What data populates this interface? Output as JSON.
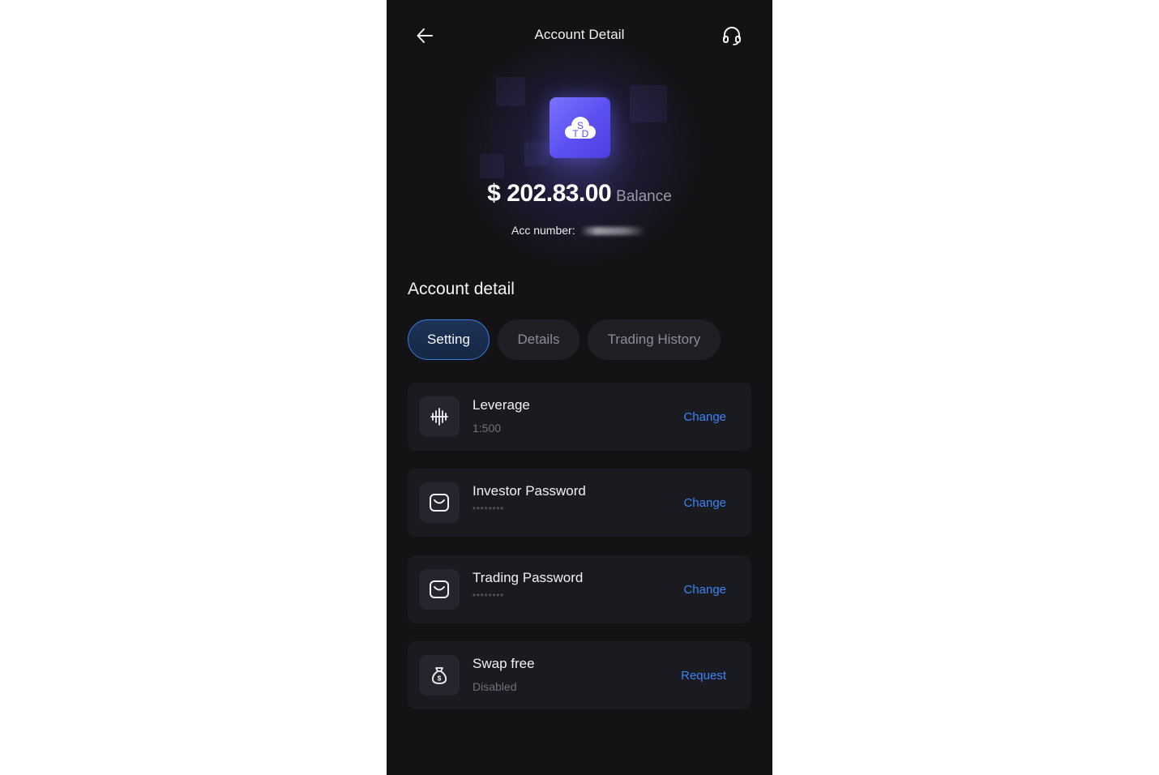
{
  "header": {
    "title": "Account Detail",
    "back_icon": "arrow-left-icon",
    "support_icon": "headset-icon"
  },
  "account": {
    "logo_text": "STD",
    "balance": "$ 202.83.00",
    "balance_label": "Balance",
    "acc_number_label": "Acc number:"
  },
  "section": {
    "title": "Account detail"
  },
  "tabs": [
    {
      "label": "Setting",
      "active": true
    },
    {
      "label": "Details",
      "active": false
    },
    {
      "label": "Trading History",
      "active": false
    }
  ],
  "settings": [
    {
      "title": "Leverage",
      "value": "1:500",
      "action": "Change",
      "icon": "leverage-icon"
    },
    {
      "title": "Investor Password",
      "value": "********",
      "action": "Change",
      "icon": "wallet-icon"
    },
    {
      "title": "Trading Password",
      "value": "********",
      "action": "Change",
      "icon": "wallet-icon"
    },
    {
      "title": "Swap free",
      "value": "Disabled",
      "action": "Request",
      "icon": "money-bag-icon"
    }
  ],
  "colors": {
    "background": "#131316",
    "accent": "#3d83f5",
    "logo": "#6a5ff5"
  }
}
